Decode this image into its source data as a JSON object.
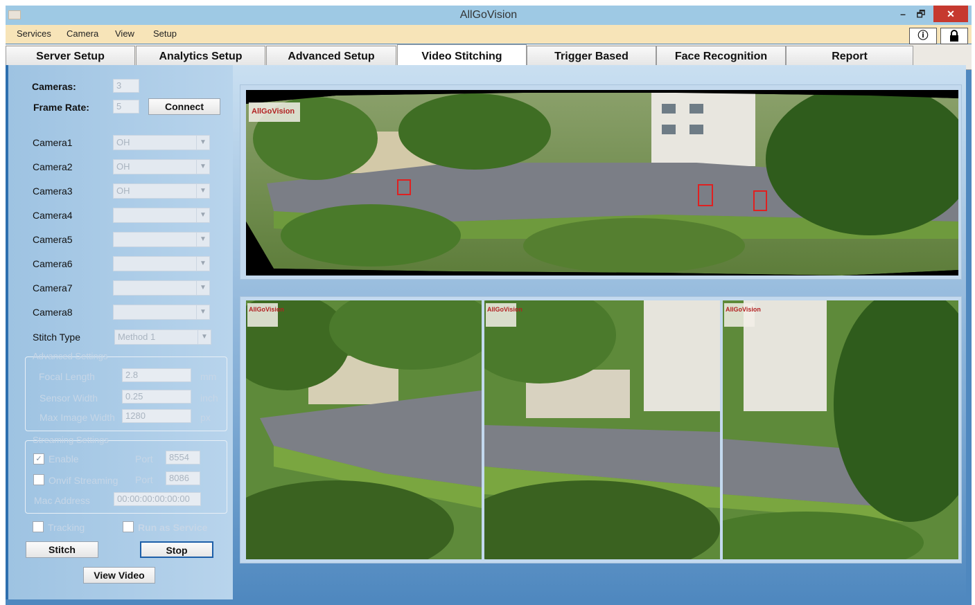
{
  "app": {
    "title": "AllGoVision",
    "controls": {
      "minimize": "–",
      "maximize": "🗗",
      "close": "✕"
    }
  },
  "menu": [
    "Services",
    "Camera",
    "View",
    "Setup"
  ],
  "toolbar_icons": [
    "info-icon",
    "lock-icon"
  ],
  "tabs": [
    "Server Setup",
    "Analytics Setup",
    "Advanced Setup",
    "Video Stitching",
    "Trigger Based",
    "Face Recognition",
    "Report"
  ],
  "active_tab": "Video Stitching",
  "left": {
    "cameras_label": "Cameras:",
    "cameras_value": "3",
    "frame_rate_label": "Frame Rate:",
    "frame_rate_value": "5",
    "connect_label": "Connect",
    "cameras": [
      {
        "label": "Camera1",
        "value": "OH"
      },
      {
        "label": "Camera2",
        "value": "OH"
      },
      {
        "label": "Camera3",
        "value": "OH"
      },
      {
        "label": "Camera4",
        "value": ""
      },
      {
        "label": "Camera5",
        "value": ""
      },
      {
        "label": "Camera6",
        "value": ""
      },
      {
        "label": "Camera7",
        "value": ""
      },
      {
        "label": "Camera8",
        "value": ""
      }
    ],
    "stitch_type_label": "Stitch Type",
    "stitch_type_value": "Method 1",
    "advanced": {
      "title": "Advanced Settings",
      "focal_length_label": "Focal Length",
      "focal_length_value": "2.8",
      "focal_length_unit": "mm",
      "sensor_width_label": "Sensor Width",
      "sensor_width_value": "0.25",
      "sensor_width_unit": "inch",
      "max_width_label": "Max Image Width",
      "max_width_value": "1280",
      "max_width_unit": "px"
    },
    "streaming": {
      "title": "Streaming Settings",
      "enable_label": "Enable",
      "enable_checked": true,
      "port_label": "Port",
      "port_value": "8554",
      "onvif_label": "Onvif Streaming",
      "onvif_checked": false,
      "onvif_port_label": "Port",
      "onvif_port_value": "8086",
      "mac_label": "Mac Address",
      "mac_value": "00:00:00:00:00:00"
    },
    "tracking_label": "Tracking",
    "run_service_label": "Run as Service",
    "stitch_btn": "Stitch",
    "stop_btn": "Stop",
    "view_video_btn": "View Video"
  },
  "watermark": "AllGoVision",
  "colors": {
    "accent": "#2e6fae",
    "close_red": "#c6392f",
    "menu_bg": "#f7e4b8",
    "detection_box": "#e02020"
  }
}
